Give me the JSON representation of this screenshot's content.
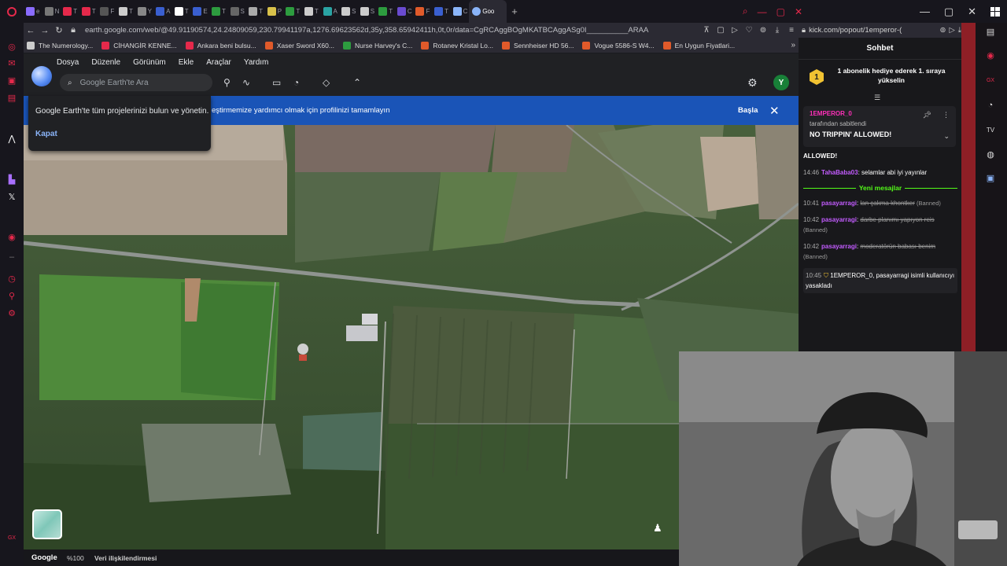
{
  "browser": {
    "tabs": [
      {
        "label": "e",
        "fav": "#8a6cff"
      },
      {
        "label": "N",
        "fav": "#777"
      },
      {
        "label": "T",
        "fav": "#e5294b"
      },
      {
        "label": "T",
        "fav": "#e5294b"
      },
      {
        "label": "F",
        "fav": "#555"
      },
      {
        "label": "T",
        "fav": "#ccc"
      },
      {
        "label": "Y",
        "fav": "#888"
      },
      {
        "label": "A",
        "fav": "#3a5fd0"
      },
      {
        "label": "T",
        "fav": "#fff"
      },
      {
        "label": "E",
        "fav": "#3a5fd0"
      },
      {
        "label": "T",
        "fav": "#2d9c3f"
      },
      {
        "label": "S",
        "fav": "#666"
      },
      {
        "label": "T",
        "fav": "#aaa"
      },
      {
        "label": "P",
        "fav": "#d8c14a"
      },
      {
        "label": "T",
        "fav": "#2d9c3f"
      },
      {
        "label": "T",
        "fav": "#ccc"
      },
      {
        "label": "A",
        "fav": "#2aa3a3"
      },
      {
        "label": "S",
        "fav": "#ccc"
      },
      {
        "label": "S",
        "fav": "#ccc"
      },
      {
        "label": "T",
        "fav": "#2d9c3f"
      },
      {
        "label": "C",
        "fav": "#6a4bd0"
      },
      {
        "label": "F",
        "fav": "#e05a2a"
      },
      {
        "label": "T",
        "fav": "#3a5fd0"
      },
      {
        "label": "C",
        "fav": "#8ab4f8"
      }
    ],
    "active_tab": "Goo",
    "new_tab": "+",
    "url": "earth.google.com/web/@49.91190574,24.24809059,230.79941197a,1276.69623562d,35y,358.65942411h,0t,0r/data=CgRCAggBOgMKATBCAggASg0I__________ARAA",
    "bookmarks": [
      {
        "label": "The Numerology...",
        "fav": "#ccc"
      },
      {
        "label": "CİHANGİR KENNE...",
        "fav": "#e5294b"
      },
      {
        "label": "Ankara beni bulsu...",
        "fav": "#e5294b"
      },
      {
        "label": "Xaser Sword X60...",
        "fav": "#e05a2a"
      },
      {
        "label": "Nurse Harvey's C...",
        "fav": "#2d9c3f"
      },
      {
        "label": "Rotanev Kristal Lo...",
        "fav": "#e05a2a"
      },
      {
        "label": "Sennheiser HD 56...",
        "fav": "#e05a2a"
      },
      {
        "label": "Vogue 5586-S W4...",
        "fav": "#e05a2a"
      },
      {
        "label": "En Uygun Fiyatlari...",
        "fav": "#e05a2a"
      }
    ],
    "bookmarks_more": "»"
  },
  "earth": {
    "menu": [
      "Dosya",
      "Düzenle",
      "Görünüm",
      "Ekle",
      "Araçlar",
      "Yardım"
    ],
    "search_placeholder": "Google Earth'te Ara",
    "avatar_letter": "Y",
    "banner_text": "eştirmemize yardımcı olmak için profilinizi tamamlayın",
    "banner_start": "Başla",
    "banner_close": "✕",
    "popup_text": "Google Earth'te tüm projelerinizi bulun ve yönetin.",
    "popup_close": "Kapat",
    "status_google": "Google",
    "status_zoom": "%100",
    "status_credit": "Veri ilişkilendirmesi"
  },
  "chat": {
    "url": "kick.com/popout/1emperor-(",
    "title": "Sohbet",
    "sub_badge": "1",
    "sub_text": "1 abonelik hediye ederek 1. sıraya yükselin",
    "pinned_user": "1EMPEROR_0",
    "pinned_by": "tarafından sabitlendi",
    "pinned_msg": "NO TRIPPIN' ALLOWED!",
    "allowed": "ALLOWED!",
    "msg1": {
      "time": "14:46",
      "user": "TahaBaba03",
      "text": ": selamlar abi iyi yayınlar"
    },
    "new_label": "Yeni mesajlar",
    "banned1": {
      "time": "10:41",
      "user": "pasayarragi",
      "text": "lan çakma khontker",
      "status": "(Banned)"
    },
    "banned2": {
      "time": "10:42",
      "user": "pasayarragi",
      "text": "darbe planımı yapıyon reis",
      "status": "(Banned)"
    },
    "banned3": {
      "time": "10:42",
      "user": "pasayarragi",
      "text": "moderatörün babası benim",
      "status": "(Banned)"
    },
    "notice": {
      "time": "10:45",
      "text": "1EMPEROR_0, pasayarragi isimli kullanıcıyı yasakladı"
    }
  },
  "colors": {
    "kick_green": "#53fc18",
    "username_purple": "#c35cff",
    "pinned_pink": "#ff2fb9",
    "banner_blue": "#1a54b7",
    "opera_red": "#e5294b"
  }
}
